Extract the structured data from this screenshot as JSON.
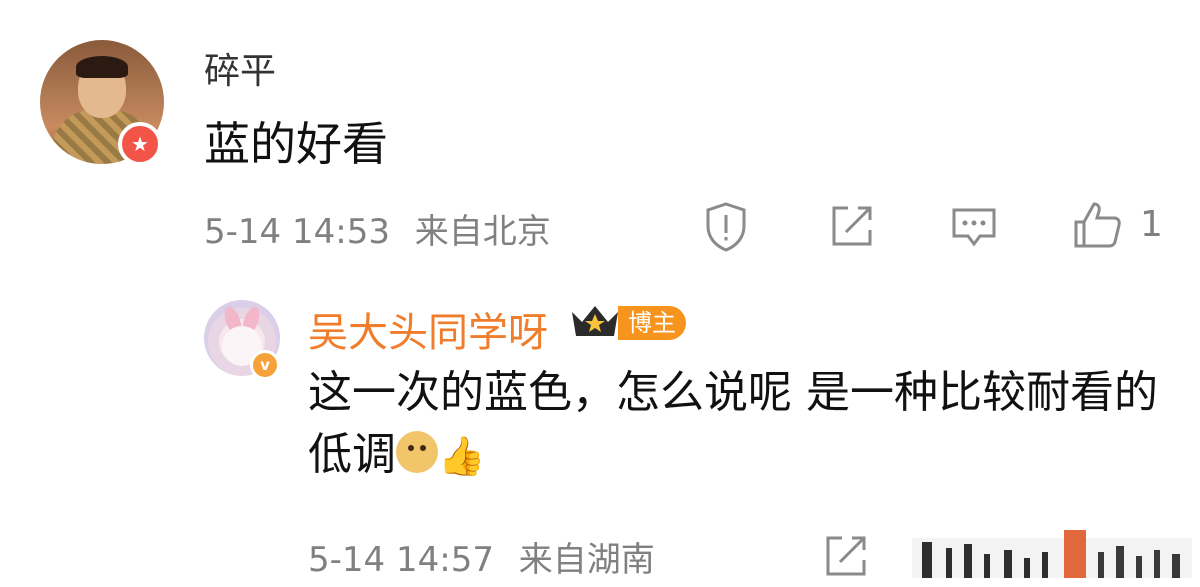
{
  "comment": {
    "username": "碎平",
    "text": "蓝的好看",
    "timestamp": "5-14 14:53",
    "location": "来自北京",
    "like_count": "1",
    "actions": [
      "report-icon",
      "share-icon",
      "reply-icon",
      "like-icon"
    ]
  },
  "reply": {
    "username": "吴大头同学呀",
    "badge": "博主",
    "text": "这一次的蓝色，怎么说呢 是一种比较耐看的低调",
    "emojis": [
      "doge-emoji",
      "thumbs-up-emoji"
    ],
    "timestamp": "5-14 14:57",
    "location": "来自湖南",
    "actions": [
      "share-icon",
      "chart-icon"
    ]
  },
  "colors": {
    "username_accent": "#ef7d2b",
    "badge_bg": "#f7941e",
    "meta_gray": "#808080"
  }
}
